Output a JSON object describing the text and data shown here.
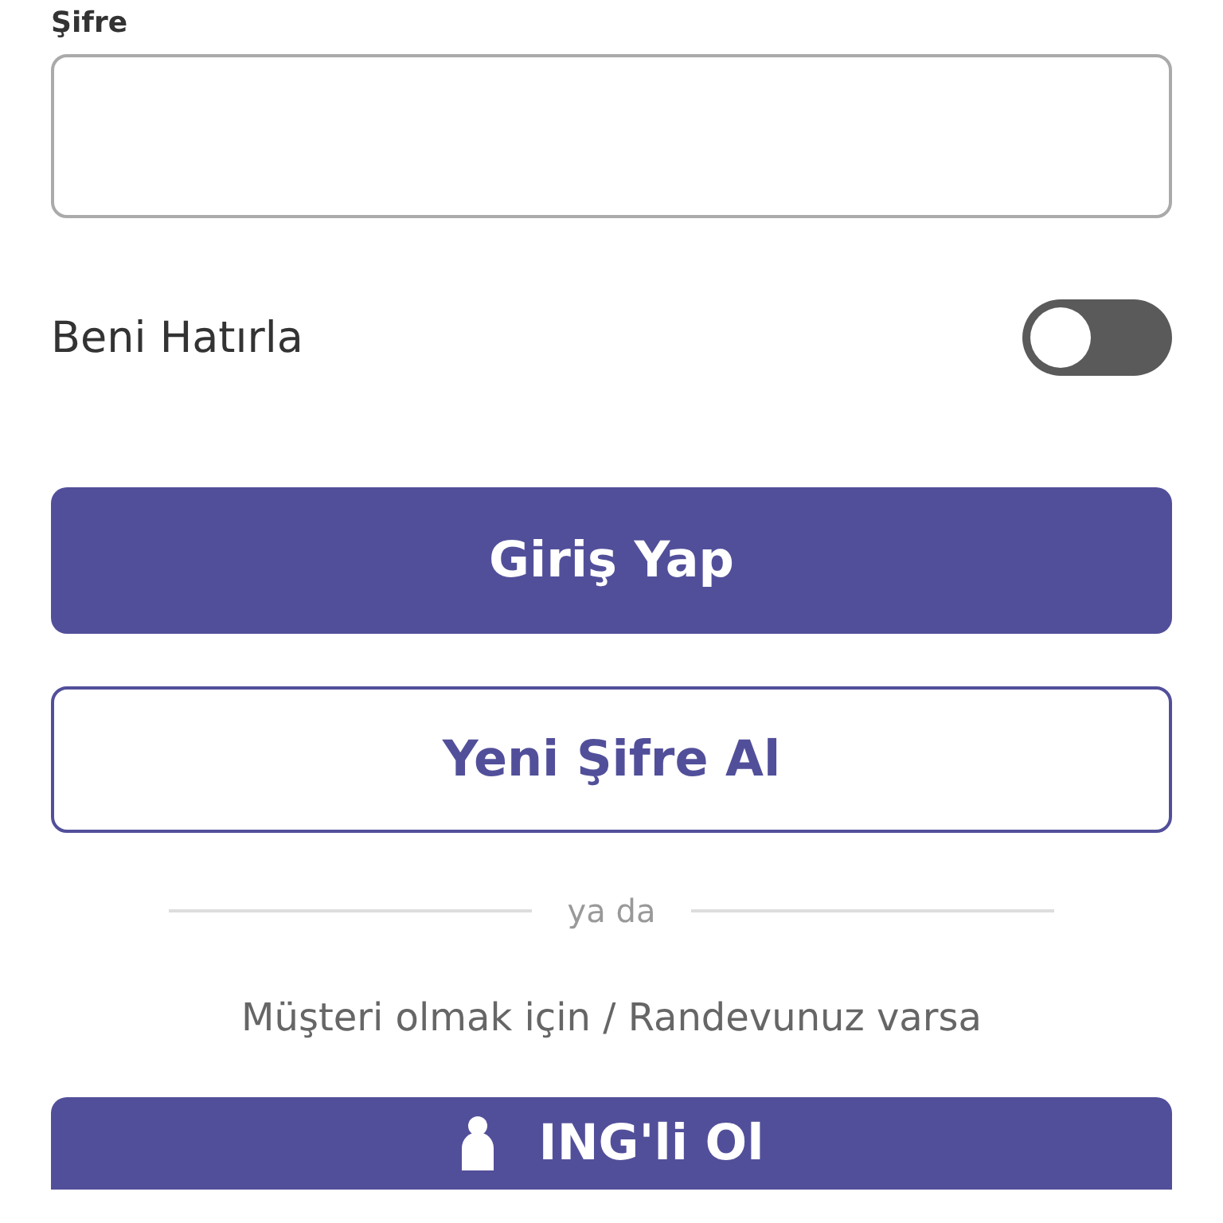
{
  "password": {
    "label": "Şifre"
  },
  "remember_me": {
    "label": "Beni Hatırla",
    "on": false
  },
  "login_button": "Giriş Yap",
  "new_password_button": "Yeni Şifre Al",
  "divider": "ya da",
  "customer_hint": "Müşteri olmak için / Randevunuz varsa",
  "become_customer_button": "ING'li Ol"
}
